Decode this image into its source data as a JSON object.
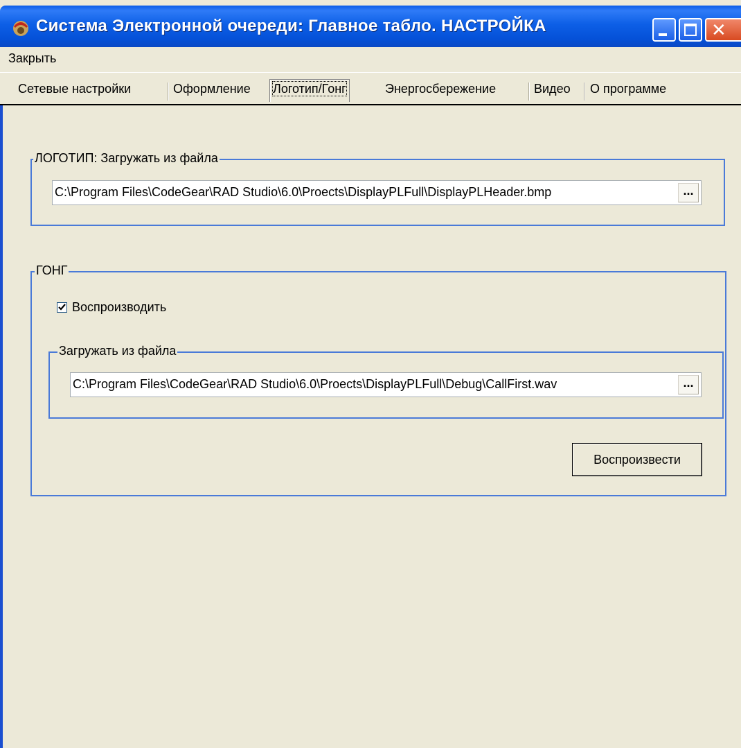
{
  "window": {
    "title": "Система  Электронной очереди: Главное табло. НАСТРОЙКА",
    "title_color": "#0551d8"
  },
  "menu": {
    "close_label": "Закрыть"
  },
  "tabs": [
    {
      "label": "Сетевые настройки",
      "active": false
    },
    {
      "label": "Оформление",
      "active": false
    },
    {
      "label": "Логотип/Гонг",
      "active": true
    },
    {
      "label": "Энергосбережение",
      "active": false
    },
    {
      "label": "Видео",
      "active": false
    },
    {
      "label": "О программе",
      "active": false
    }
  ],
  "logo_group": {
    "title": "ЛОГОТИП: Загружать из файла",
    "path": "C:\\Program Files\\CodeGear\\RAD Studio\\6.0\\Proects\\DisplayPLFull\\DisplayPLHeader.bmp",
    "browse_label": "..."
  },
  "gong_group": {
    "title": "ГОНГ",
    "play_checkbox_label": "Воспроизводить",
    "play_checked": true,
    "file_group_title": "Загружать из файла",
    "path": "C:\\Program Files\\CodeGear\\RAD Studio\\6.0\\Proects\\DisplayPLFull\\Debug\\CallFirst.wav",
    "browse_label": "...",
    "play_button_label": "Воспроизвести"
  },
  "colors": {
    "groupbox_border": "#4a7ad8",
    "background": "#ece9d8"
  }
}
